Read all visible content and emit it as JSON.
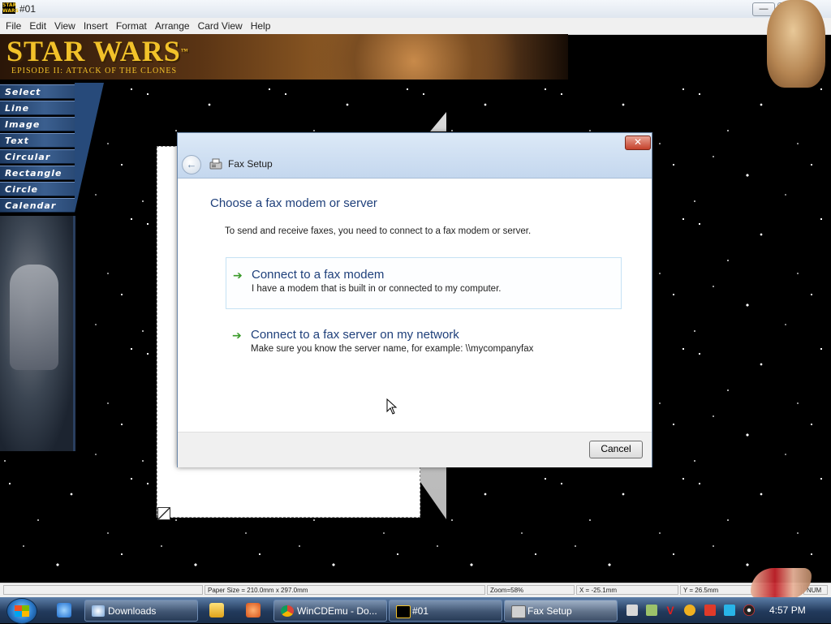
{
  "window": {
    "title": "#01",
    "app_icon_text": "STAR WARS",
    "minimize_glyph": "—",
    "maximize_glyph": "□"
  },
  "menu": [
    "File",
    "Edit",
    "View",
    "Insert",
    "Format",
    "Arrange",
    "Card View",
    "Help"
  ],
  "banner": {
    "logo": "STAR WARS",
    "trademark": "™",
    "subtitle": "EPISODE II: ATTACK OF THE CLONES"
  },
  "tools": [
    "Select",
    "Line",
    "Image",
    "Text",
    "Circular Text",
    "Rectangle",
    "Circle",
    "Calendar"
  ],
  "dialog": {
    "title": "Fax Setup",
    "close_glyph": "✕",
    "back_glyph": "←",
    "heading": "Choose a fax modem or server",
    "description": "To send and receive faxes, you need to connect to a fax modem or server.",
    "options": [
      {
        "title": "Connect to a fax modem",
        "subtitle": "I have a modem that is built in or connected to my computer."
      },
      {
        "title": "Connect to a fax server on my network",
        "subtitle": "Make sure you know the server name, for example: \\\\mycompanyfax"
      }
    ],
    "arrow_glyph": "➔",
    "cancel_label": "Cancel"
  },
  "statusbar": {
    "paper_size": "Paper Size = 210.0mm x 297.0mm",
    "zoom": "Zoom=58%",
    "x": "X = -25.1mm",
    "y": "Y = 26.5mm",
    "num": "NUM"
  },
  "taskbar": {
    "items": [
      {
        "label": "Downloads",
        "icon": "folder-icon"
      },
      {
        "label": "WinCDEmu - Do...",
        "icon": "chrome-icon"
      },
      {
        "label": "#01",
        "icon": "starwars-app-icon"
      },
      {
        "label": "Fax Setup",
        "icon": "fax-icon"
      }
    ],
    "clock": "4:57 PM"
  },
  "colors": {
    "accent_heading": "#1e3f7a",
    "option_arrow": "#3a9a2a",
    "tool_button": "#2d4d7a",
    "banner_logo": "#f2c22a"
  }
}
